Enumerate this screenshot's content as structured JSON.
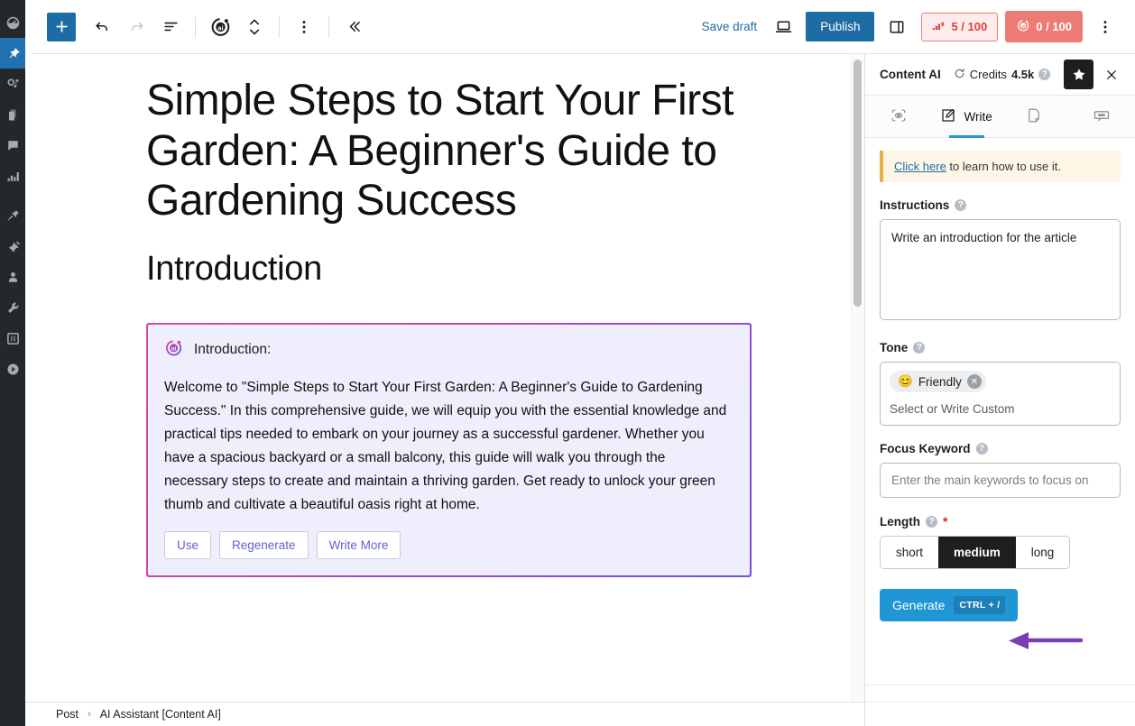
{
  "wp_rail": {
    "items": [
      {
        "name": "dashboard",
        "icon": "dashboard-icon",
        "active": false
      },
      {
        "name": "posts",
        "icon": "pin-icon",
        "active": true
      },
      {
        "name": "media",
        "icon": "media-icon",
        "active": false
      },
      {
        "name": "pages",
        "icon": "pages-icon",
        "active": false
      },
      {
        "name": "comments",
        "icon": "comment-icon",
        "active": false
      },
      {
        "name": "analytics",
        "icon": "bar-chart-icon",
        "active": false
      },
      {
        "name": "appearance",
        "icon": "brush-icon",
        "active": false
      },
      {
        "name": "plugins",
        "icon": "plug-icon",
        "active": false
      },
      {
        "name": "users",
        "icon": "user-icon",
        "active": false
      },
      {
        "name": "tools",
        "icon": "wrench-icon",
        "active": false
      },
      {
        "name": "settings",
        "icon": "settings-sliders-icon",
        "active": false
      },
      {
        "name": "collapse",
        "icon": "play-circle-icon",
        "active": false
      }
    ]
  },
  "toolbar": {
    "add_block_label": "+",
    "add_block_name": "add-block-button",
    "undo_label": "Undo",
    "redo_label": "Redo",
    "list_view_label": "Document overview",
    "content_ai_label": "Content AI",
    "updown_label": "Move up or down",
    "options_label": "Options",
    "collapse_label": "Collapse",
    "save_draft_label": "Save draft",
    "preview_label": "Preview",
    "publish_label": "Publish",
    "settings_panel_label": "Settings",
    "seo_score": "5 / 100",
    "content_ai_score": "0 / 100",
    "more_label": "Options"
  },
  "editor": {
    "title": "Simple Steps to Start Your First Garden: A Beginner's Guide to Gardening Success",
    "heading": "Introduction",
    "ai_card": {
      "logo_icon": "content-ai-logo-icon",
      "label": "Introduction:",
      "body": "Welcome to \"Simple Steps to Start Your First Garden: A Beginner's Guide to Gardening Success.\" In this comprehensive guide, we will equip you with the essential knowledge and practical tips needed to embark on your journey as a successful gardener. Whether you have a spacious backyard or a small balcony, this guide will walk you through the necessary steps to create and maintain a thriving garden. Get ready to unlock your green thumb and cultivate a beautiful oasis right at home.",
      "actions": [
        {
          "label": "Use",
          "name": "use-button"
        },
        {
          "label": "Regenerate",
          "name": "regenerate-button"
        },
        {
          "label": "Write More",
          "name": "write-more-button"
        }
      ]
    }
  },
  "breadcrumb": {
    "items": [
      "Post",
      "AI Assistant [Content AI]"
    ],
    "separator": "›"
  },
  "sidebar": {
    "title": "Content AI",
    "credits_label": "Credits",
    "credits_value": "4.5k",
    "refresh_icon": "refresh-icon",
    "help_icon": "help-icon",
    "star_icon": "star-icon",
    "close_icon": "close-icon",
    "tabs": [
      {
        "label": "",
        "icon": "research-eye-icon",
        "active": false,
        "name": "tab-research"
      },
      {
        "label": "Write",
        "icon": "write-pencil-icon",
        "active": true,
        "name": "tab-write"
      },
      {
        "label": "",
        "icon": "document-icon",
        "active": false,
        "name": "tab-document"
      },
      {
        "label": "",
        "icon": "chat-icon",
        "active": false,
        "name": "tab-chat"
      }
    ],
    "notice": {
      "link_text": "Click here",
      "text": " to learn how to use it."
    },
    "instructions": {
      "label": "Instructions",
      "value": "Write an introduction for the article",
      "placeholder": "Write an introduction for the article"
    },
    "tone": {
      "label": "Tone",
      "chip_emoji": "😊",
      "chip_label": "Friendly",
      "chip_remove": "✕",
      "placeholder": "Select or Write Custom"
    },
    "focus_keyword": {
      "label": "Focus Keyword",
      "value": "",
      "placeholder": "Enter the main keywords to focus on"
    },
    "length": {
      "label": "Length",
      "required_marker": "*",
      "options": [
        {
          "label": "short",
          "active": false
        },
        {
          "label": "medium",
          "active": true
        },
        {
          "label": "long",
          "active": false
        }
      ]
    },
    "generate": {
      "label": "Generate",
      "shortcut": "CTRL + /"
    }
  },
  "annotation": {
    "arrow_color": "#7b3fb5",
    "points_at": "generate-button"
  },
  "colors": {
    "accent_blue": "#2196d4",
    "publish_blue": "#1e6ca4",
    "seo_red": "#d9443c",
    "ai_red": "#ec7a75",
    "card_gradient_start": "#d54b9c",
    "card_gradient_end": "#7a4fd6",
    "card_bg": "#eeeefc",
    "notice_bg": "#fdf6e6",
    "notice_border": "#e3b341",
    "rail_bg": "#23282d",
    "rail_active": "#2271b1"
  }
}
